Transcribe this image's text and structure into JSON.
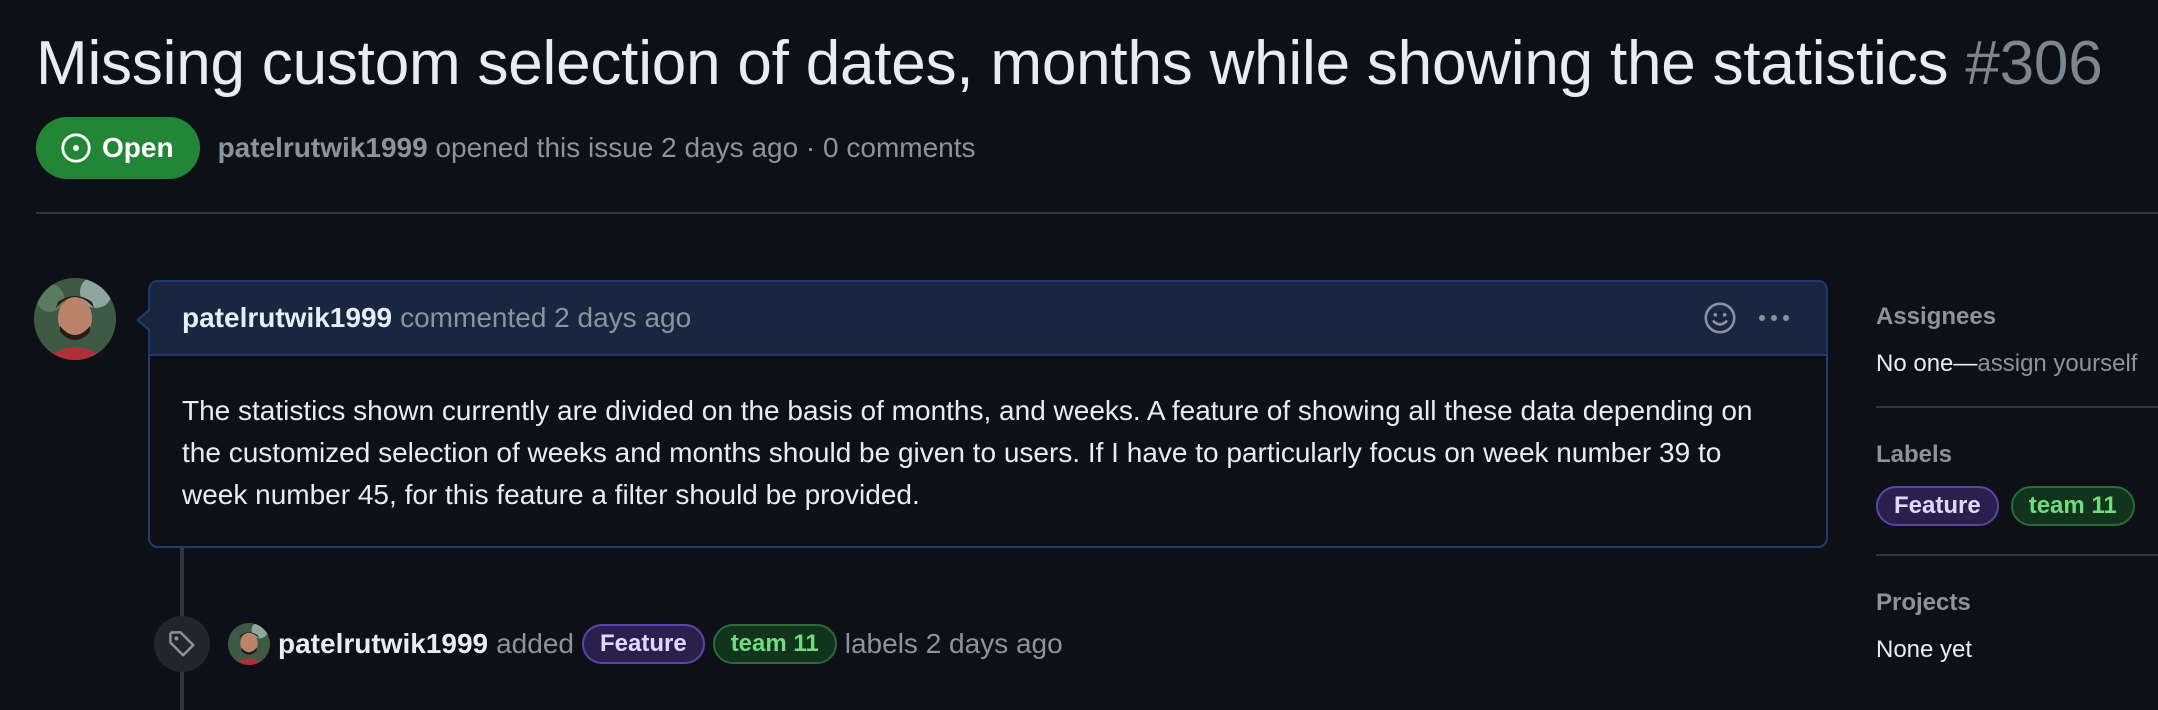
{
  "issue": {
    "title": "Missing custom selection of dates, months while showing the statistics",
    "number": "#306",
    "state": "Open",
    "author": "patelrutwik1999",
    "opened_text": "opened this issue 2 days ago · 0 comments"
  },
  "comment": {
    "author": "patelrutwik1999",
    "meta": "commented 2 days ago",
    "body": "The statistics shown currently are divided on the basis of months, and weeks. A feature of showing all these data depending on the customized selection of weeks and months should be given to users. If I have to particularly focus on week number 39 to week number 45, for this feature a filter should be provided."
  },
  "timeline_event": {
    "author": "patelrutwik1999",
    "action": "added",
    "labels": [
      "Feature",
      "team 11"
    ],
    "suffix": "labels 2 days ago"
  },
  "sidebar": {
    "assignees": {
      "heading": "Assignees",
      "value_prefix": "No one—",
      "value_link": "assign yourself"
    },
    "labels": {
      "heading": "Labels",
      "items": [
        "Feature",
        "team 11"
      ]
    },
    "projects": {
      "heading": "Projects",
      "value": "None yet"
    }
  },
  "colors": {
    "background": "#0d1117",
    "open_badge": "#238636",
    "comment_header": "#182640",
    "comment_border": "#1f3a6e",
    "label_feature_bg": "#2a1f4d",
    "label_team_bg": "#12331c"
  },
  "icons": [
    "issue-opened-icon",
    "smiley-icon",
    "kebab-menu-icon",
    "tag-icon"
  ]
}
